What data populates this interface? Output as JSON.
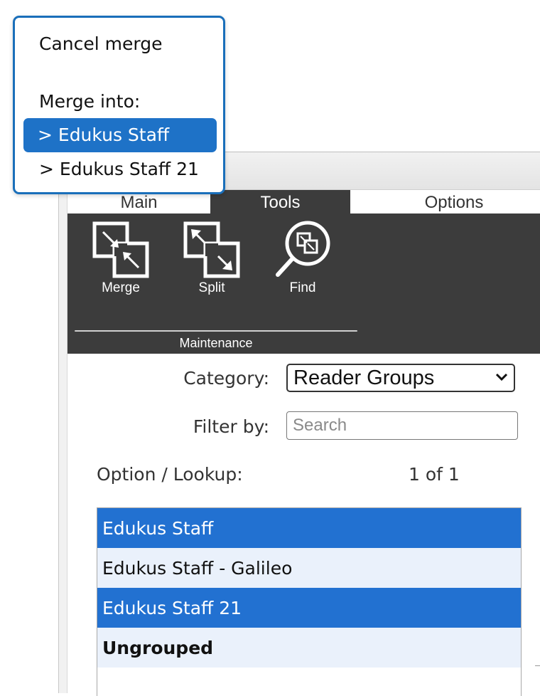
{
  "tabs": [
    {
      "label": "Main"
    },
    {
      "label": "Tools"
    },
    {
      "label": "Options"
    }
  ],
  "ribbon": {
    "buttons": [
      {
        "label": "Merge",
        "icon": "merge-icon"
      },
      {
        "label": "Split",
        "icon": "split-icon"
      },
      {
        "label": "Find",
        "icon": "find-magnifier-icon"
      }
    ],
    "group_label": "Maintenance"
  },
  "form": {
    "category_label": "Category:",
    "category_value": "Reader Groups",
    "filter_label": "Filter by:",
    "filter_placeholder": "Search",
    "filter_value": "",
    "lookup_label": "Option / Lookup:",
    "counter": "1 of 1"
  },
  "list": {
    "rows": [
      {
        "label": "Edukus Staff",
        "state": "selected"
      },
      {
        "label": "Edukus Staff - Galileo",
        "state": "normal"
      },
      {
        "label": "Edukus Staff 21",
        "state": "selected"
      },
      {
        "label": "Ungrouped",
        "state": "bold"
      }
    ]
  },
  "popup": {
    "cancel_label": "Cancel merge",
    "header": "Merge into:",
    "options": [
      {
        "label": "> Edukus Staff",
        "highlighted": true
      },
      {
        "label": "> Edukus Staff 21",
        "highlighted": false
      }
    ]
  },
  "colors": {
    "selection": "#2271d1",
    "popup_border": "#1a6fba",
    "ribbon_bg": "#3c3c3c",
    "alt_row": "#eaf1fb"
  }
}
